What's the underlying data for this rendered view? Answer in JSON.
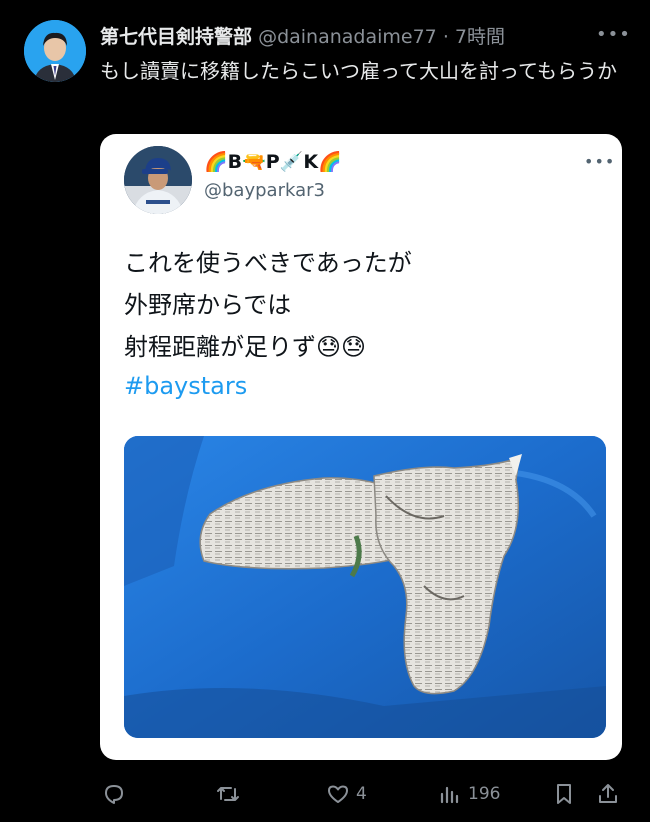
{
  "post": {
    "author_name": "第七代目剣持警部",
    "handle": "@dainanadaime77",
    "separator": "·",
    "time": "7時間",
    "more_label": "•••",
    "text": "もし讀賣に移籍したらこいつ雇って大山を討ってもらうか"
  },
  "quote": {
    "name": "🌈B🔫P💉K🌈",
    "handle": "@bayparkar3",
    "more_label": "•••",
    "lines": [
      "これを使うべきであったが",
      "外野席からでは",
      "射程距離が足りず😓😓"
    ],
    "hashtag": "#baystars"
  },
  "actions": {
    "reply_count": "",
    "retweet_count": "",
    "like_count": "4",
    "views_count": "196"
  },
  "colors": {
    "background": "#000000",
    "card": "#ffffff",
    "link": "#1d9bf0",
    "muted": "#8b9198",
    "avatar_bg": "#29a3ef",
    "seat_blue": "#1e70d4"
  },
  "icons": [
    "reply-icon",
    "retweet-icon",
    "like-icon",
    "views-icon",
    "bookmark-icon",
    "share-icon"
  ]
}
